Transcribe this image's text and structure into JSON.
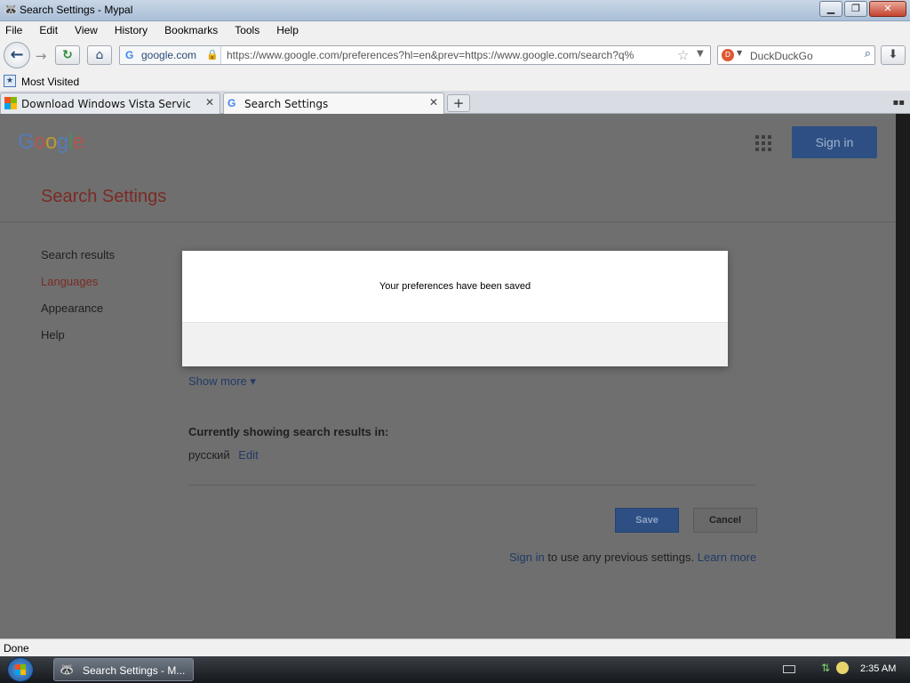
{
  "window": {
    "title": "Search Settings - Mypal",
    "minimize": "▁",
    "maximize": "❐",
    "close": "✕"
  },
  "menu": [
    "File",
    "Edit",
    "View",
    "History",
    "Bookmarks",
    "Tools",
    "Help"
  ],
  "nav": {
    "identity_domain": "google.com",
    "url": "https://www.google.com/preferences?hl=en&prev=https://www.google.com/search?q%",
    "search_engine_placeholder": "DuckDuckGo"
  },
  "bookmarks": {
    "most_visited": "Most Visited"
  },
  "tabs": [
    {
      "label": "Download Windows Vista Service ..."
    },
    {
      "label": "Search Settings"
    }
  ],
  "page": {
    "logo": [
      "G",
      "o",
      "o",
      "g",
      "l",
      "e"
    ],
    "logo_colors": [
      "#4285f4",
      "#ea4335",
      "#fbbc05",
      "#4285f4",
      "#34a853",
      "#ea4335"
    ],
    "signin": "Sign in",
    "title": "Search Settings",
    "sidebar": [
      "Search results",
      "Languages",
      "Appearance",
      "Help"
    ],
    "sidebar_active_index": 1,
    "show_more": "Show more ▾",
    "currently_showing": "Currently showing search results in:",
    "current_language": "русский",
    "edit": "Edit",
    "save": "Save",
    "cancel": "Cancel",
    "signin_link": "Sign in",
    "signin_note": " to use any previous settings. ",
    "learn_more": "Learn more"
  },
  "modal": {
    "message": "Your preferences have been saved"
  },
  "status": {
    "text": "Done"
  },
  "taskbar": {
    "item_label": "Search Settings - M...",
    "clock": "2:35 AM"
  },
  "colors": {
    "accent": "#4285f4",
    "settings_red": "#c5221f",
    "overlay": "#6f6f6f"
  }
}
